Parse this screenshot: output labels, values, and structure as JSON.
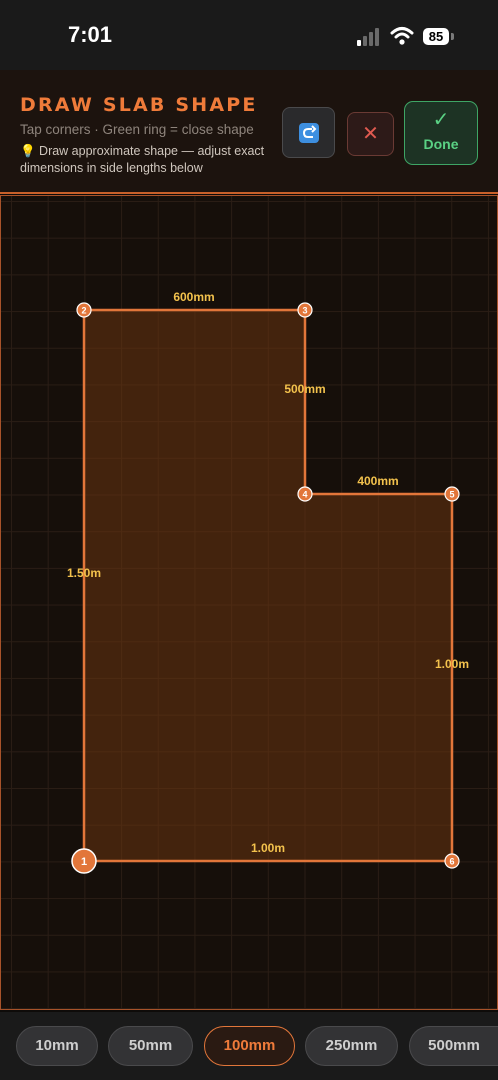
{
  "status_bar": {
    "time": "7:01",
    "battery": "85",
    "icons": [
      "signal-icon",
      "wifi-icon",
      "battery-icon"
    ]
  },
  "header": {
    "title": "DRAW SLAB SHAPE",
    "subtitle": "Tap corners · Green ring = close shape",
    "hint": "💡 Draw approximate shape — adjust exact dimensions in side lengths below",
    "undo_icon": "undo-icon",
    "close_label": "✕",
    "done_check": "✓",
    "done_label": "Done"
  },
  "shape": {
    "corners": [
      "1",
      "2",
      "3",
      "4",
      "5",
      "6"
    ],
    "side_lengths": [
      "1.50m",
      "600mm",
      "500mm",
      "400mm",
      "1.00m",
      "1.00m"
    ]
  },
  "grid_sizes": {
    "options": [
      "10mm",
      "50mm",
      "100mm",
      "250mm",
      "500mm"
    ],
    "selected": "100mm"
  },
  "colors": {
    "accent": "#ef7b3a",
    "outline": "#e2763a",
    "dimension_text": "#f3c24d",
    "done_green": "#5ad184",
    "close_red": "#e05a50"
  }
}
